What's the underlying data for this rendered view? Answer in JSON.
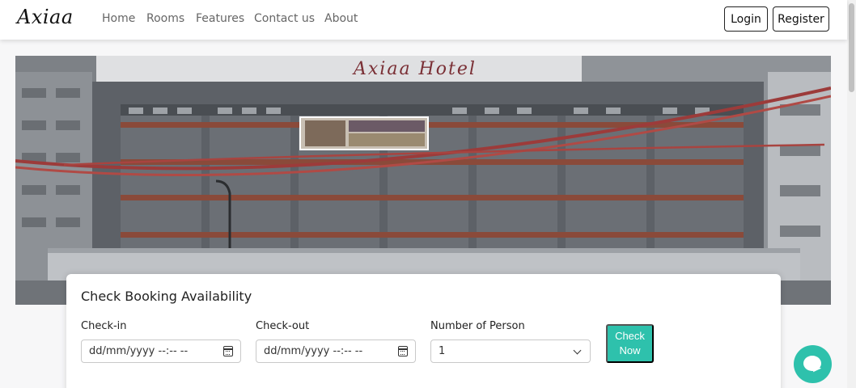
{
  "brand": "Axiaa",
  "nav": {
    "links": [
      "Home",
      "Rooms",
      "Features",
      "Contact us",
      "About"
    ],
    "login": "Login",
    "register": "Register"
  },
  "hero": {
    "sign_text": "Axiaa Hotel",
    "alt": "hotel-facade-image"
  },
  "booking": {
    "title": "Check Booking Availability",
    "checkin_label": "Check-in",
    "checkin_placeholder": "dd/mm/yyyy --:-- --",
    "checkout_label": "Check-out",
    "checkout_placeholder": "dd/mm/yyyy --:-- --",
    "persons_label": "Number of Person",
    "persons_value": "1",
    "check_button": "Check Now"
  },
  "colors": {
    "accent": "#2ec1ac"
  },
  "icons": {
    "calendar": "calendar-icon",
    "dropdown": "chevron-down-icon",
    "chat": "chat-icon"
  }
}
